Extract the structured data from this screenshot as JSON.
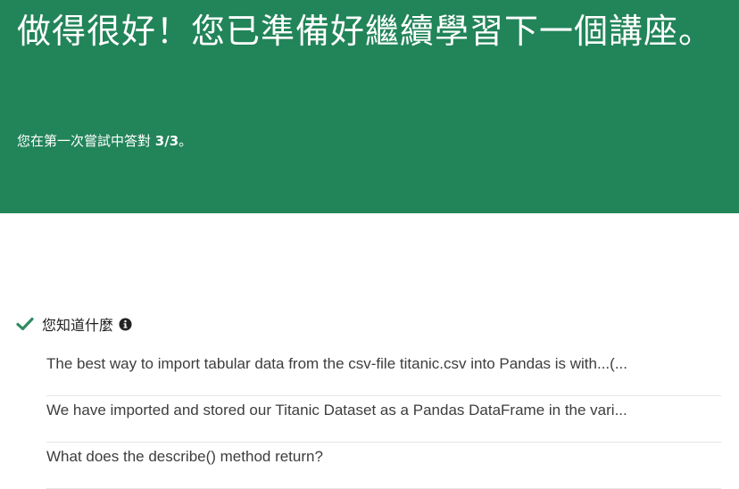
{
  "banner": {
    "title": "做得很好！您已準備好繼續學習下一個講座。",
    "subtitle_prefix": "您在第一次嘗試中答對 ",
    "score": "3/3",
    "subtitle_suffix": "。"
  },
  "section": {
    "title": "您知道什麼",
    "check_icon": "check-icon",
    "info_icon": "info-icon"
  },
  "questions": [
    {
      "text": "The best way to import tabular data from the csv-file titanic.csv into Pandas is with...(..."
    },
    {
      "text": "We have imported and stored our Titanic Dataset as a Pandas DataFrame in the vari..."
    },
    {
      "text": "What does the describe() method return?"
    }
  ],
  "colors": {
    "banner_bg": "#228459",
    "check": "#2e8b63",
    "text": "#3d3d3d"
  }
}
